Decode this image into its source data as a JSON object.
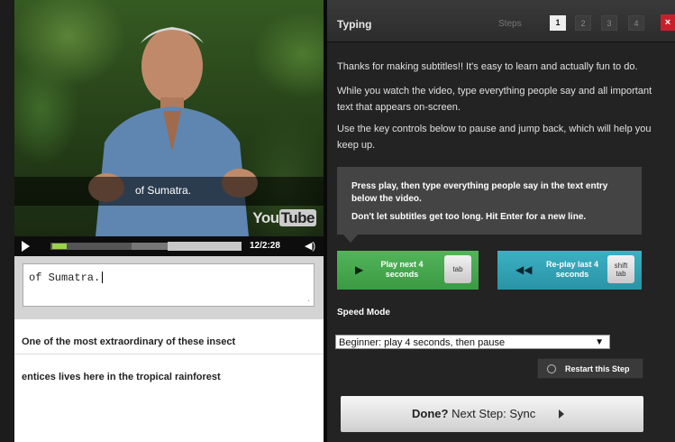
{
  "video": {
    "subtitle": "of Sumatra.",
    "logo": "YouTube",
    "time": "12/2:28"
  },
  "entry": {
    "value": "of Sumatra."
  },
  "subtitles": [
    "One of the most extraordinary of these insect",
    "entices lives here in the tropical rainforest"
  ],
  "panel": {
    "title": "Typing",
    "steps_label": "Steps",
    "steps": [
      "1",
      "2",
      "3",
      "4"
    ],
    "close": "×",
    "para1": "Thanks for making subtitles!! It's easy to learn and actually fun to do.",
    "para2": "While you watch the video, type everything people say and all important text that appears on-screen.",
    "para3": "Use the key controls below to pause and jump back, which will help you keep up.",
    "callout1": "Press play, then type everything people say in the text entry below the video.",
    "callout2": "Don't let subtitles get too long. Hit Enter for a new line."
  },
  "buttons": {
    "play_label": "Play next 4 seconds",
    "play_key": "tab",
    "replay_label": "Re-play last 4 seconds",
    "replay_key_1": "shift",
    "replay_key_2": "tab"
  },
  "speed": {
    "label": "Speed Mode",
    "selected": "Beginner: play 4 seconds, then pause"
  },
  "restart_label": "Restart this Step",
  "done": {
    "bold": "Done?",
    "rest": " Next Step: Sync"
  },
  "colors": {
    "play_green": "#4caf54",
    "replay_teal": "#35a6b8",
    "close_red": "#c8202a",
    "progress_green": "#9bd34a"
  },
  "progress_fraction": 0.08
}
